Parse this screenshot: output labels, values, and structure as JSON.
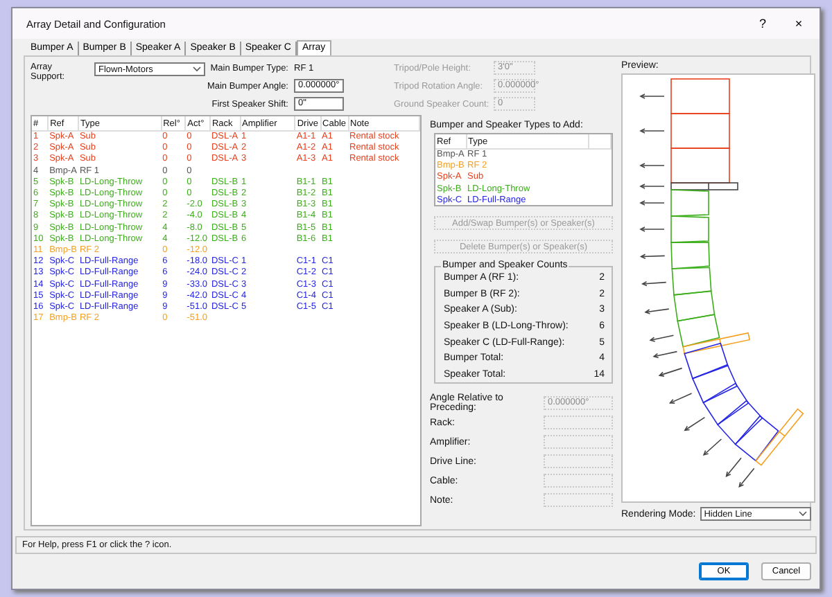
{
  "window": {
    "title": "Array Detail and Configuration",
    "help": "?",
    "close": "×"
  },
  "tabs": [
    {
      "label": "Bumper A",
      "selected": false
    },
    {
      "label": "Bumper B",
      "selected": false
    },
    {
      "label": "Speaker A",
      "selected": false
    },
    {
      "label": "Speaker B",
      "selected": false
    },
    {
      "label": "Speaker C",
      "selected": false
    },
    {
      "label": "Array",
      "selected": true
    }
  ],
  "array_support": {
    "label": "Array Support:",
    "value": "Flown-Motors"
  },
  "main_fields": [
    {
      "label": "Main Bumper Type:",
      "value": "RF 1",
      "kind": "text"
    },
    {
      "label": "Main Bumper Angle:",
      "value": "0.000000°",
      "kind": "input"
    },
    {
      "label": "First Speaker Shift:",
      "value": "0\"",
      "kind": "input"
    }
  ],
  "tripod_fields": [
    {
      "label": "Tripod/Pole Height:",
      "value": "3'0\"",
      "disabled": true
    },
    {
      "label": "Tripod Rotation Angle:",
      "value": "0.000000°",
      "disabled": true
    },
    {
      "label": "Ground Speaker Count:",
      "value": "0",
      "disabled": true
    }
  ],
  "table": {
    "columns": [
      "#",
      "Ref",
      "Type",
      "Rel°",
      "Act°",
      "Rack",
      "Amplifier",
      "Drive",
      "Cable",
      "Note"
    ],
    "rows": [
      {
        "kind": "sub",
        "color": "#e8401c",
        "num": "1",
        "ref": "Spk-A",
        "type": "Sub",
        "rel": "0",
        "act": "0",
        "rack": "DSL-A",
        "amplifier": "1",
        "drive": "A1-1",
        "cable": "A1",
        "note": "Rental stock"
      },
      {
        "kind": "sub",
        "color": "#e8401c",
        "num": "2",
        "ref": "Spk-A",
        "type": "Sub",
        "rel": "0",
        "act": "0",
        "rack": "DSL-A",
        "amplifier": "2",
        "drive": "A1-2",
        "cable": "A1",
        "note": "Rental stock"
      },
      {
        "kind": "sub",
        "color": "#e8401c",
        "num": "3",
        "ref": "Spk-A",
        "type": "Sub",
        "rel": "0",
        "act": "0",
        "rack": "DSL-A",
        "amplifier": "3",
        "drive": "A1-3",
        "cable": "A1",
        "note": "Rental stock"
      },
      {
        "kind": "bumper",
        "color": "#555555",
        "num": "4",
        "ref": "Bmp-A",
        "type": "RF 1",
        "rel": "0",
        "act": "0"
      },
      {
        "kind": "line",
        "color": "#3cae1a",
        "num": "5",
        "ref": "Spk-B",
        "type": "LD-Long-Throw",
        "rel": "0",
        "act": "0",
        "rack": "DSL-B",
        "amplifier": "1",
        "drive": "B1-1",
        "cable": "B1"
      },
      {
        "kind": "line",
        "color": "#3cae1a",
        "num": "6",
        "ref": "Spk-B",
        "type": "LD-Long-Throw",
        "rel": "0",
        "act": "0",
        "rack": "DSL-B",
        "amplifier": "2",
        "drive": "B1-2",
        "cable": "B1"
      },
      {
        "kind": "line",
        "color": "#3cae1a",
        "num": "7",
        "ref": "Spk-B",
        "type": "LD-Long-Throw",
        "rel": "2",
        "act": "-2.0",
        "rack": "DSL-B",
        "amplifier": "3",
        "drive": "B1-3",
        "cable": "B1"
      },
      {
        "kind": "line",
        "color": "#3cae1a",
        "num": "8",
        "ref": "Spk-B",
        "type": "LD-Long-Throw",
        "rel": "2",
        "act": "-4.0",
        "rack": "DSL-B",
        "amplifier": "4",
        "drive": "B1-4",
        "cable": "B1"
      },
      {
        "kind": "line",
        "color": "#3cae1a",
        "num": "9",
        "ref": "Spk-B",
        "type": "LD-Long-Throw",
        "rel": "4",
        "act": "-8.0",
        "rack": "DSL-B",
        "amplifier": "5",
        "drive": "B1-5",
        "cable": "B1"
      },
      {
        "kind": "line",
        "color": "#3cae1a",
        "num": "10",
        "ref": "Spk-B",
        "type": "LD-Long-Throw",
        "rel": "4",
        "act": "-12.0",
        "rack": "DSL-B",
        "amplifier": "6",
        "drive": "B1-6",
        "cable": "B1"
      },
      {
        "kind": "bumper",
        "color": "#f5a020",
        "num": "11",
        "ref": "Bmp-B",
        "type": "RF 2",
        "rel": "0",
        "act": "-12.0"
      },
      {
        "kind": "line",
        "color": "#2424e6",
        "num": "12",
        "ref": "Spk-C",
        "type": "LD-Full-Range",
        "rel": "6",
        "act": "-18.0",
        "rack": "DSL-C",
        "amplifier": "1",
        "drive": "C1-1",
        "cable": "C1"
      },
      {
        "kind": "line",
        "color": "#2424e6",
        "num": "13",
        "ref": "Spk-C",
        "type": "LD-Full-Range",
        "rel": "6",
        "act": "-24.0",
        "rack": "DSL-C",
        "amplifier": "2",
        "drive": "C1-2",
        "cable": "C1"
      },
      {
        "kind": "line",
        "color": "#2424e6",
        "num": "14",
        "ref": "Spk-C",
        "type": "LD-Full-Range",
        "rel": "9",
        "act": "-33.0",
        "rack": "DSL-C",
        "amplifier": "3",
        "drive": "C1-3",
        "cable": "C1"
      },
      {
        "kind": "line",
        "color": "#2424e6",
        "num": "15",
        "ref": "Spk-C",
        "type": "LD-Full-Range",
        "rel": "9",
        "act": "-42.0",
        "rack": "DSL-C",
        "amplifier": "4",
        "drive": "C1-4",
        "cable": "C1"
      },
      {
        "kind": "line",
        "color": "#2424e6",
        "num": "16",
        "ref": "Spk-C",
        "type": "LD-Full-Range",
        "rel": "9",
        "act": "-51.0",
        "rack": "DSL-C",
        "amplifier": "5",
        "drive": "C1-5",
        "cable": "C1"
      },
      {
        "kind": "bumper",
        "color": "#f5a020",
        "num": "17",
        "ref": "Bmp-B",
        "type": "RF 2",
        "rel": "0",
        "act": "-51.0"
      }
    ]
  },
  "types_to_add": {
    "title": "Bumper and Speaker Types to Add:",
    "columns": [
      "Ref",
      "Type"
    ],
    "rows": [
      {
        "ref": "Bmp-A",
        "type": "RF 1",
        "color": "#555555"
      },
      {
        "ref": "Bmp-B",
        "type": "RF 2",
        "color": "#f5a020"
      },
      {
        "ref": "Spk-A",
        "type": "Sub",
        "color": "#e8401c"
      },
      {
        "ref": "Spk-B",
        "type": "LD-Long-Throw",
        "color": "#3cae1a"
      },
      {
        "ref": "Spk-C",
        "type": "LD-Full-Range",
        "color": "#2424e6"
      }
    ]
  },
  "action_buttons": [
    {
      "label": "Add/Swap Bumper(s) or Speaker(s)",
      "disabled": true
    },
    {
      "label": "Delete Bumper(s) or Speaker(s)",
      "disabled": true
    }
  ],
  "counts": {
    "title": "Bumper and Speaker Counts",
    "items": [
      {
        "label": "Bumper A (RF 1):",
        "value": "2"
      },
      {
        "label": "Bumper B (RF 2):",
        "value": "2"
      },
      {
        "label": "Speaker A (Sub):",
        "value": "3"
      },
      {
        "label": "Speaker B (LD-Long-Throw):",
        "value": "6"
      },
      {
        "label": "Speaker C (LD-Full-Range):",
        "value": "5"
      },
      {
        "label": "Bumper Total:",
        "value": "4"
      },
      {
        "label": "Speaker Total:",
        "value": "14"
      }
    ]
  },
  "properties": [
    {
      "label": "Angle Relative to Preceding:",
      "value": "0.000000°",
      "disabled": true
    },
    {
      "label": "Rack:",
      "disabled": true
    },
    {
      "label": "Amplifier:",
      "disabled": true
    },
    {
      "label": "Drive Line:",
      "disabled": true
    },
    {
      "label": "Cable:",
      "disabled": true
    },
    {
      "label": "Note:",
      "disabled": true
    }
  ],
  "preview": {
    "label": "Preview:"
  },
  "rendering_mode": {
    "label": "Rendering Mode:",
    "value": "Hidden Line"
  },
  "status_bar": "For Help, press F1 or click the ? icon.",
  "dialog_buttons": [
    {
      "label": "OK",
      "default": true
    },
    {
      "label": "Cancel",
      "default": false
    }
  ]
}
